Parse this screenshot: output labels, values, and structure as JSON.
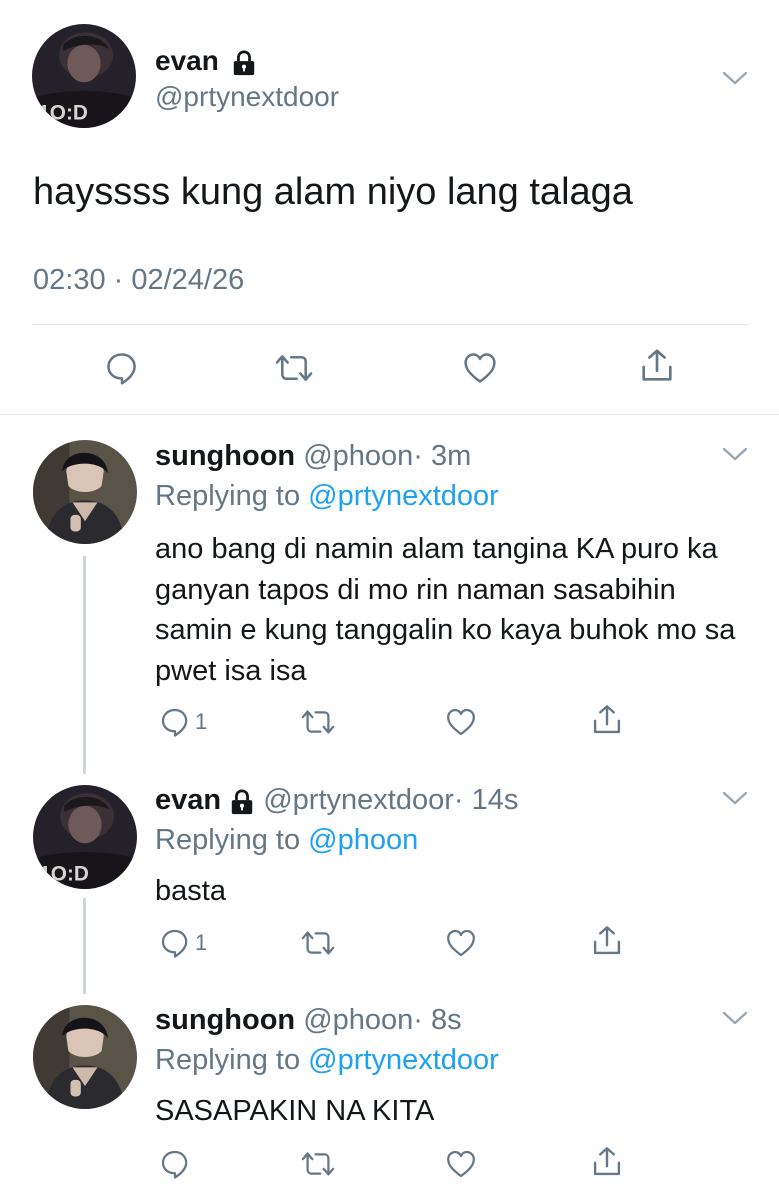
{
  "main_tweet": {
    "name": "evan",
    "handle": "@prtynextdoor",
    "text": "hayssss kung alam niyo lang talaga",
    "timestamp": "02:30 · 02/24/26"
  },
  "replies": [
    {
      "name": "sunghoon",
      "handle": "@phoon",
      "time": "· 3m",
      "replying_label": "Replying to",
      "replying_to": "@prtynextdoor",
      "text": "ano bang di namin alam tangina KA puro ka ganyan tapos di mo rin naman sasabihin samin e kung tanggalin ko kaya buhok mo sa pwet isa isa",
      "reply_count": "1"
    },
    {
      "name": "evan",
      "handle": "@prtynextdoor",
      "time": "· 14s",
      "replying_label": "Replying to",
      "replying_to": "@phoon",
      "text": "basta",
      "reply_count": "1"
    },
    {
      "name": "sunghoon",
      "handle": "@phoon",
      "time": "· 8s",
      "replying_label": "Replying to",
      "replying_to": "@prtynextdoor",
      "text": "SASAPAKIN NA KITA",
      "reply_count": ""
    }
  ],
  "icons": {
    "reply": "speech-bubble-icon",
    "retweet": "retweet-arrows-icon",
    "like": "heart-icon",
    "share": "share-upload-icon",
    "more": "chevron-down-icon",
    "protected": "lock-icon"
  },
  "colors": {
    "link_blue": "#1da1f2",
    "secondary_gray": "#657786",
    "divider": "#e1e8ed"
  }
}
